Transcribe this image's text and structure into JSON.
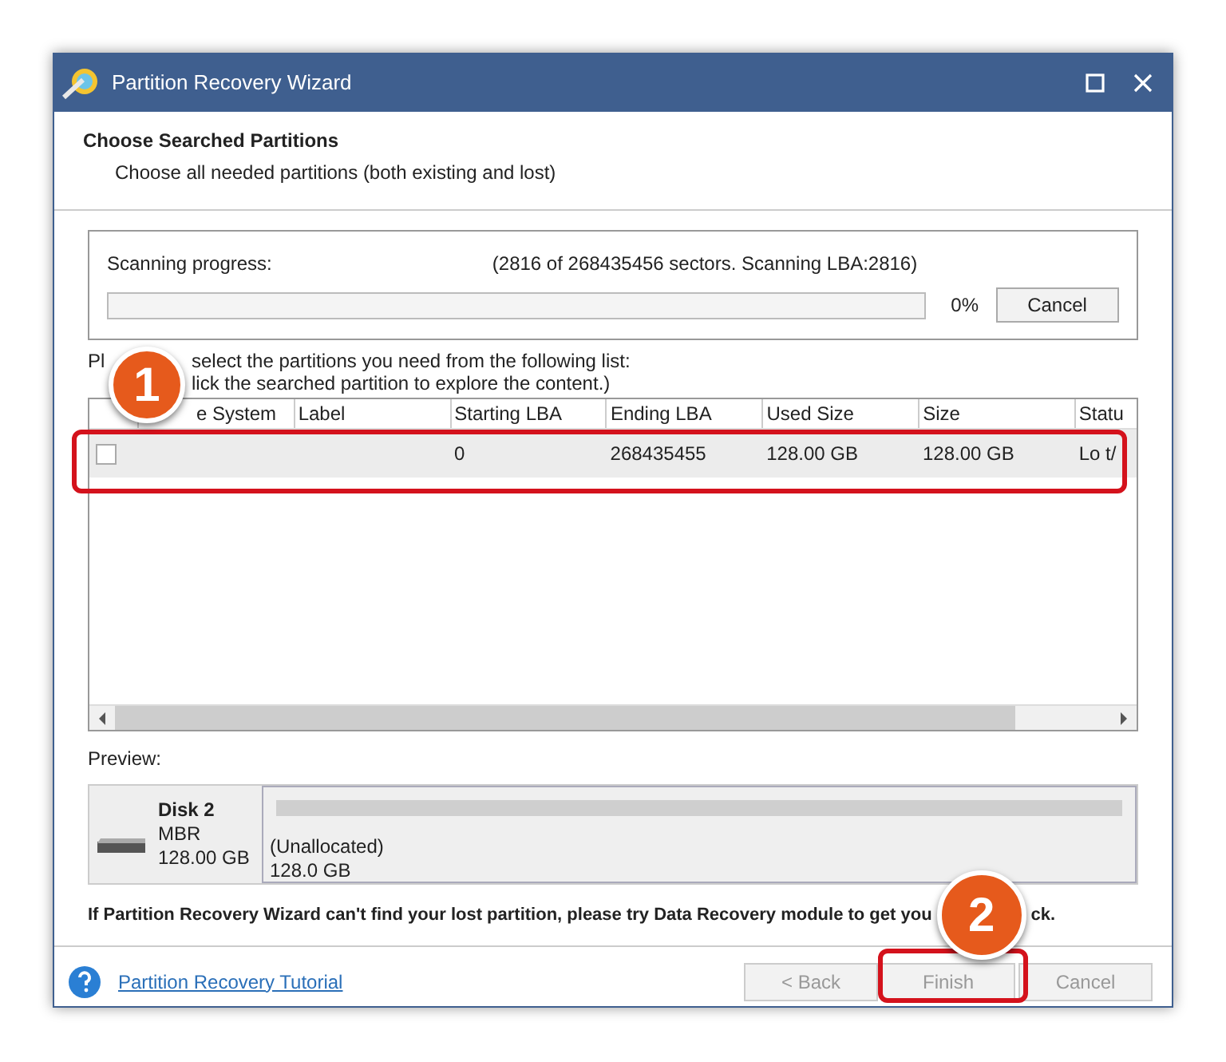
{
  "window": {
    "title": "Partition Recovery Wizard"
  },
  "header": {
    "title": "Choose Searched Partitions",
    "subtitle": "Choose all needed partitions (both existing and lost)"
  },
  "scan": {
    "label": "Scanning progress:",
    "detail": "(2816 of 268435456 sectors. Scanning LBA:2816)",
    "level": 0,
    "percent": "0%",
    "cancel": "Cancel"
  },
  "instructions": [
    {
      "before": "Pl",
      "after": "select the partitions you need from the following list:"
    },
    {
      "after": "lick the searched partition to explore the content.)"
    }
  ],
  "table": {
    "columns": [
      "e System",
      "Label",
      "Starting LBA",
      "Ending LBA",
      "Used Size",
      "Size",
      "Statu"
    ],
    "rows": [
      {
        "checked": false,
        "cells": [
          "",
          "",
          "0",
          "268435455",
          "128.00 GB",
          "128.00 GB",
          "Lo t/"
        ]
      }
    ]
  },
  "preview": {
    "label": "Preview:",
    "disk": {
      "name": "Disk 2",
      "type": "MBR",
      "size": "128.00 GB"
    },
    "partition": {
      "label": "(Unallocated)",
      "size": "128.0 GB"
    }
  },
  "notice": {
    "before": "If Partition Recovery Wizard can't find your lost partition, please try Data Recovery module to get you",
    "after": "ck."
  },
  "footer": {
    "link": "Partition Recovery Tutorial",
    "buttons": [
      {
        "label": "< Back",
        "disabled": true
      },
      {
        "label": "Finish",
        "disabled": true
      },
      {
        "label": "Cancel",
        "disabled": true
      }
    ]
  },
  "annotations": [
    {
      "number": "1"
    },
    {
      "number": "2"
    }
  ]
}
